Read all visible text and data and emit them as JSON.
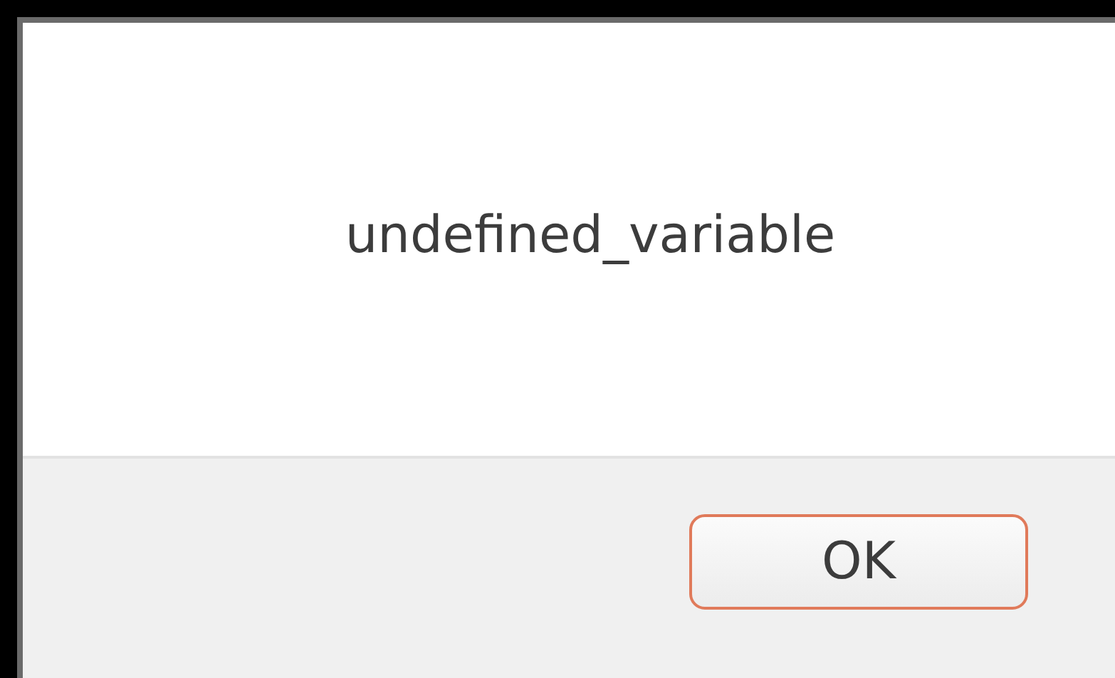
{
  "dialog": {
    "message": "undefined_variable",
    "buttons": [
      {
        "label": "OK",
        "focused": true
      }
    ]
  }
}
